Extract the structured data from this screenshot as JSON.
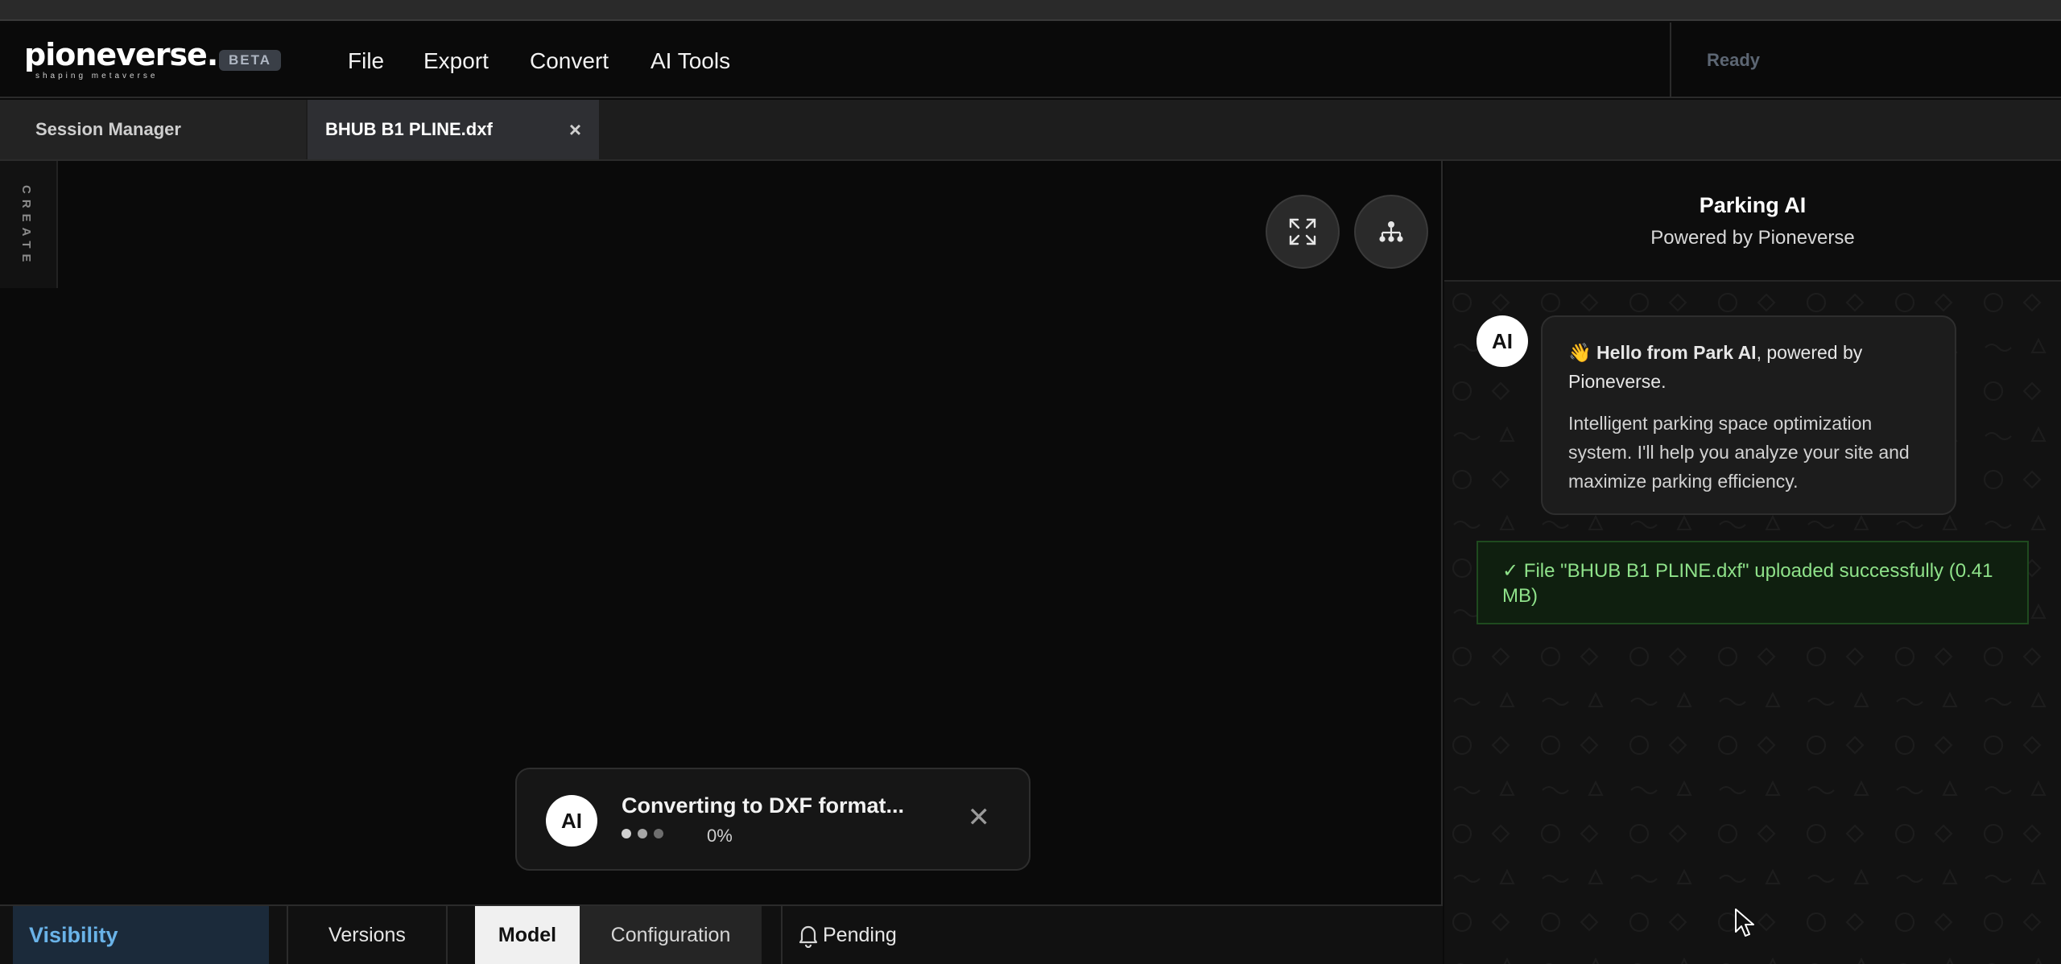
{
  "app": {
    "logo_text": "pioneverse.",
    "logo_tagline": "shaping metaverse",
    "beta_badge": "BETA",
    "status": "Ready"
  },
  "menu": {
    "items": [
      "File",
      "Export",
      "Convert",
      "AI Tools"
    ]
  },
  "tabs": {
    "session_label": "Session Manager",
    "file_label": "BHUB B1 PLINE.dxf",
    "close_glyph": "×"
  },
  "sidebar": {
    "create_label": "CREATE"
  },
  "canvas_controls": {
    "fullscreen_icon": "expand-icon",
    "hierarchy_icon": "hierarchy-icon"
  },
  "toast": {
    "avatar": "AI",
    "title": "Converting to DXF format...",
    "progress": "0%",
    "close_glyph": "✕"
  },
  "bottombar": {
    "visibility": "Visibility",
    "versions": "Versions",
    "model": "Model",
    "configuration": "Configuration",
    "pending": "Pending"
  },
  "panel": {
    "title": "Parking AI",
    "subtitle": "Powered by Pioneverse",
    "avatar": "AI",
    "greeting_emoji": "👋",
    "greeting_bold": "Hello from Park AI",
    "greeting_rest": ", powered by Pioneverse.",
    "intro": "Intelligent parking space optimization system. I'll help you analyze your site and maximize parking efficiency.",
    "success_message": "✓ File \"BHUB B1 PLINE.dxf\" uploaded successfully (0.41 MB)"
  },
  "colors": {
    "accent_blue": "#6ab3e8",
    "success_green": "#8fe28a",
    "background": "#0a0a0a"
  }
}
